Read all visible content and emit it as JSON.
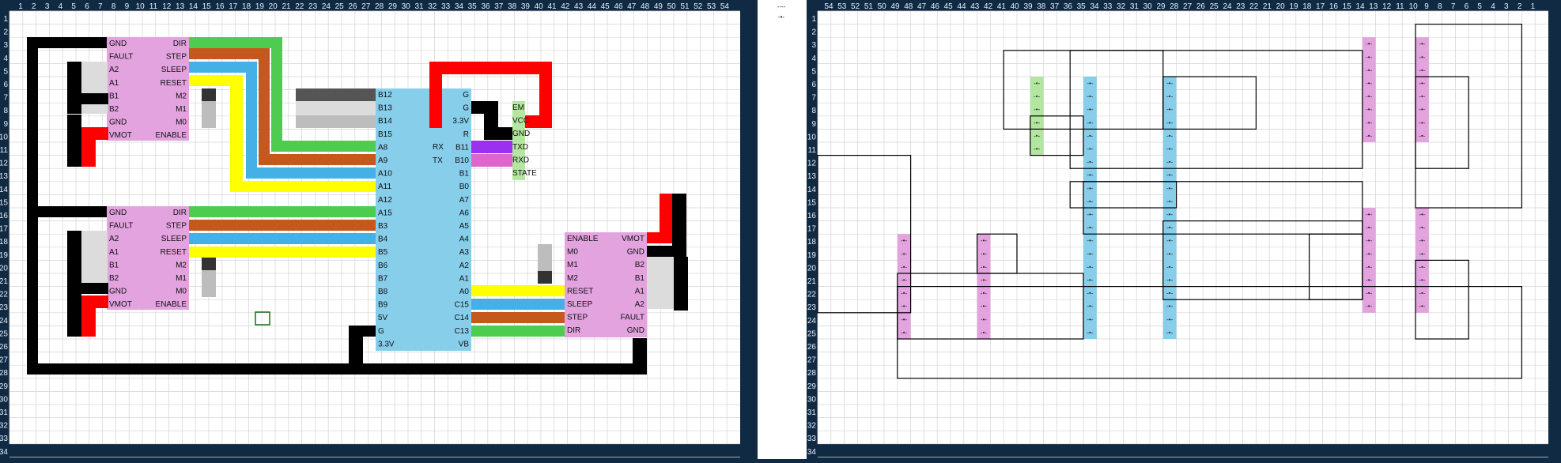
{
  "panels": {
    "left": {
      "columns": [
        "1",
        "2",
        "3",
        "4",
        "5",
        "6",
        "7",
        "8",
        "9",
        "10",
        "11",
        "12",
        "13",
        "14",
        "15",
        "16",
        "17",
        "18",
        "19",
        "20",
        "21",
        "22",
        "23",
        "24",
        "25",
        "26",
        "27",
        "28",
        "29",
        "30",
        "31",
        "32",
        "33",
        "34",
        "35",
        "36",
        "37",
        "38",
        "39",
        "40",
        "41",
        "42",
        "43",
        "44",
        "45",
        "46",
        "47",
        "48",
        "49",
        "50",
        "51",
        "52",
        "53",
        "54"
      ]
    },
    "right": {
      "columns": [
        "54",
        "53",
        "52",
        "51",
        "50",
        "49",
        "48",
        "47",
        "46",
        "45",
        "44",
        "43",
        "42",
        "41",
        "40",
        "39",
        "38",
        "37",
        "36",
        "35",
        "34",
        "33",
        "32",
        "31",
        "30",
        "29",
        "28",
        "27",
        "26",
        "25",
        "24",
        "23",
        "22",
        "21",
        "20",
        "19",
        "18",
        "17",
        "16",
        "15",
        "14",
        "13",
        "12",
        "11",
        "10",
        "9",
        "8",
        "7",
        "6",
        "5",
        "4",
        "3",
        "2",
        "1"
      ]
    },
    "rows": [
      "1",
      "2",
      "3",
      "4",
      "5",
      "6",
      "7",
      "8",
      "9",
      "10",
      "11",
      "12",
      "13",
      "14",
      "15",
      "16",
      "17",
      "18",
      "19",
      "20",
      "21",
      "22",
      "23",
      "24",
      "25",
      "26",
      "27",
      "28",
      "29",
      "30",
      "31",
      "32",
      "33",
      "34"
    ]
  },
  "legend": {
    "wire_symbol": "----",
    "via_symbol": "-•-"
  },
  "driver1_labels": {
    "left": [
      "GND",
      "FAULT",
      "A2",
      "A1",
      "B1",
      "B2",
      "GND",
      "VMOT"
    ],
    "right": [
      "DIR",
      "STEP",
      "SLEEP",
      "RESET",
      "M2",
      "M1",
      "M0",
      "ENABLE"
    ]
  },
  "driver2_labels": {
    "left": [
      "GND",
      "FAULT",
      "A2",
      "A1",
      "B1",
      "B2",
      "GND",
      "VMOT"
    ],
    "right": [
      "DIR",
      "STEP",
      "SLEEP",
      "RESET",
      "M2",
      "M1",
      "M0",
      "ENABLE"
    ]
  },
  "driver3_labels": {
    "left": [
      "ENABLE",
      "M0",
      "M1",
      "M2",
      "RESET",
      "SLEEP",
      "STEP",
      "DIR"
    ],
    "right": [
      "VMOT",
      "GND",
      "B2",
      "B1",
      "A1",
      "A2",
      "FAULT",
      "GND"
    ]
  },
  "mcu_labels": {
    "left": [
      "B12",
      "B13",
      "B14",
      "B15",
      "A8",
      "A9",
      "A10",
      "A11",
      "A12",
      "A15",
      "B3",
      "B4",
      "B5",
      "B6",
      "B7",
      "B8",
      "B9",
      "5V",
      "G",
      "3.3V"
    ],
    "right": [
      "G",
      "G",
      "3.3V",
      "R",
      "B11",
      "B10",
      "B1",
      "B0",
      "A7",
      "A6",
      "A5",
      "A4",
      "A3",
      "A2",
      "A1",
      "A0",
      "C15",
      "C14",
      "C13",
      "VB"
    ],
    "rx": "RX",
    "tx": "TX"
  },
  "bt_labels": [
    "EM",
    "VCC",
    "GND",
    "TXD",
    "RXD",
    "STATE"
  ],
  "colors": {
    "pink": "#e3a3df",
    "blue": "#87ceeb",
    "green": "#4dcc50",
    "orange": "#c5581c",
    "sky": "#45b0e6",
    "yellow": "#ffff00",
    "red": "#ff0000",
    "black": "#000000",
    "purple": "#9b30f0",
    "orchid": "#dd66cc",
    "lightgreen": "#b3e6a0"
  }
}
